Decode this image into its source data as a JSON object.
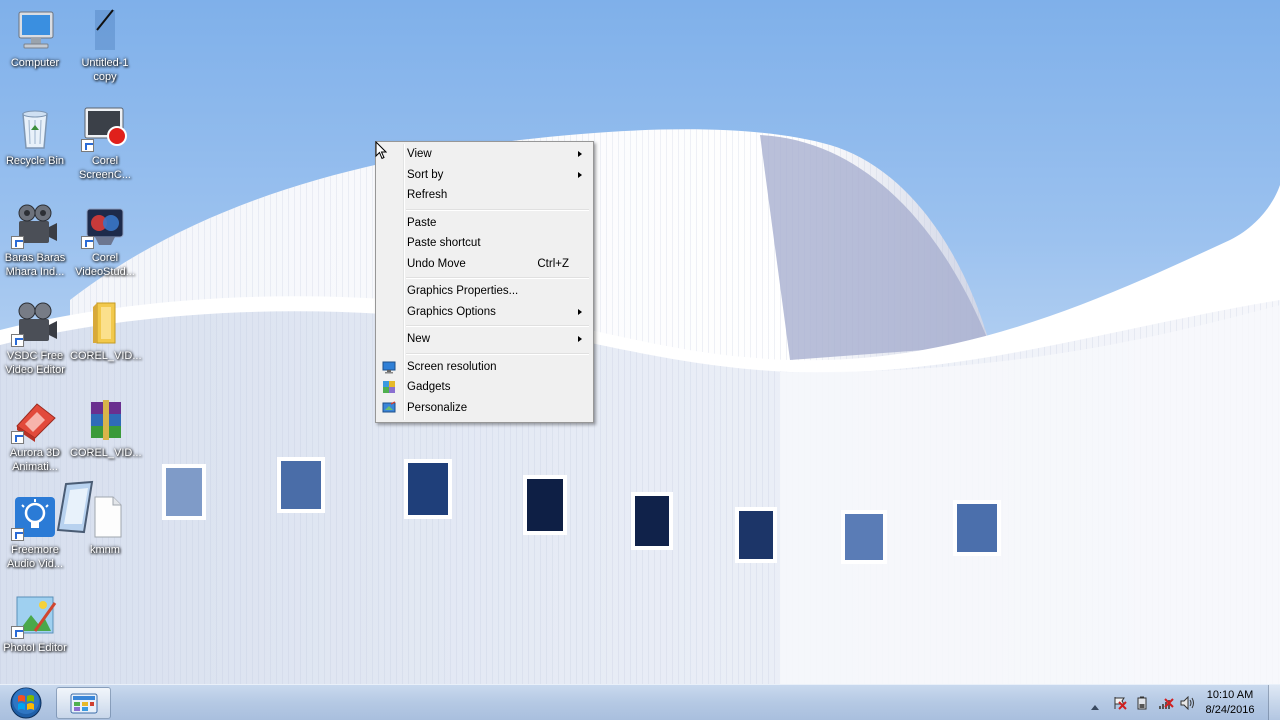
{
  "desktop": {
    "icons": [
      {
        "label": "Computer",
        "icon": "computer-icon"
      },
      {
        "label": "Untitled-1 copy",
        "icon": "image-file-icon"
      },
      {
        "label": "Recycle Bin",
        "icon": "recycle-bin-icon"
      },
      {
        "label": "Corel ScreenC...",
        "icon": "corel-screencap-icon"
      },
      {
        "label": "Baras Baras Mhara Ind...",
        "icon": "video-file-icon"
      },
      {
        "label": "Corel VideoStud...",
        "icon": "corel-videostudio-icon"
      },
      {
        "label": "VSDC Free Video Editor",
        "icon": "vsdc-editor-icon"
      },
      {
        "label": "COREL_VID...",
        "icon": "folder-icon"
      },
      {
        "label": "Aurora 3D Animati...",
        "icon": "aurora-3d-icon"
      },
      {
        "label": "COREL_VID...",
        "icon": "winrar-archive-icon"
      },
      {
        "label": "Freemore Audio Vid...",
        "icon": "freemore-icon"
      },
      {
        "label": "kmnm",
        "icon": "text-file-icon"
      },
      {
        "label": "PhotoI Editor",
        "icon": "photo-editor-icon"
      }
    ]
  },
  "context_menu": {
    "groups": [
      [
        {
          "label": "View",
          "submenu": true
        },
        {
          "label": "Sort by",
          "submenu": true
        },
        {
          "label": "Refresh"
        }
      ],
      [
        {
          "label": "Paste"
        },
        {
          "label": "Paste shortcut"
        },
        {
          "label": "Undo Move",
          "shortcut": "Ctrl+Z"
        }
      ],
      [
        {
          "label": "Graphics Properties..."
        },
        {
          "label": "Graphics Options",
          "submenu": true
        }
      ],
      [
        {
          "label": "New",
          "submenu": true
        }
      ],
      [
        {
          "label": "Screen resolution",
          "icon": "screen-resolution-icon"
        },
        {
          "label": "Gadgets",
          "icon": "gadgets-icon"
        },
        {
          "label": "Personalize",
          "icon": "personalize-icon"
        }
      ]
    ]
  },
  "taskbar": {
    "start": {
      "icon": "windows-start-icon"
    },
    "pinned": [
      {
        "icon": "control-panel-icon"
      }
    ],
    "tray_icons": [
      "show-hidden-icons-icon",
      "action-center-icon",
      "battery-icon",
      "network-icon",
      "volume-icon"
    ],
    "clock": {
      "time": "10:10 AM",
      "date": "8/24/2016"
    }
  },
  "colors": {
    "sky": "#8db8ec",
    "taskbar": "#b5c9e4",
    "menu_bg": "#f0f0f0",
    "menu_border": "#979797"
  }
}
